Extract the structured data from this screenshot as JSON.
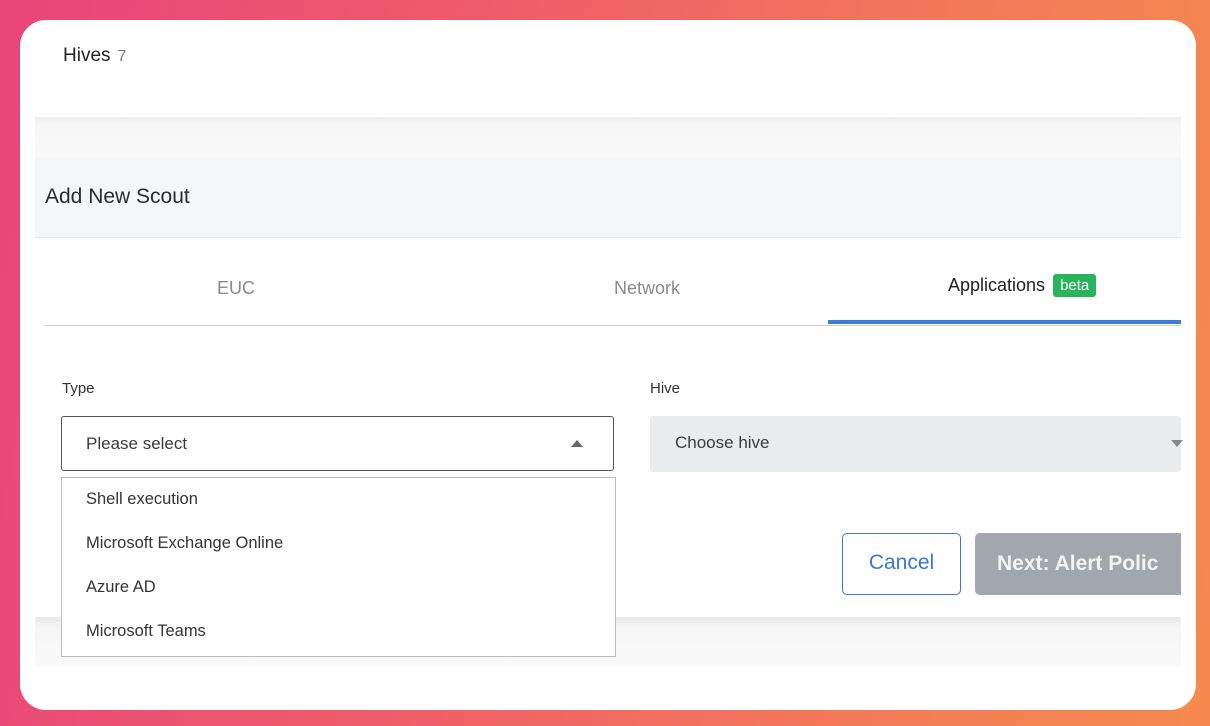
{
  "header": {
    "title": "Hives",
    "count": "7"
  },
  "panel": {
    "title": "Add New Scout"
  },
  "tabs": [
    {
      "label": "EUC"
    },
    {
      "label": "Network"
    },
    {
      "label": "Applications",
      "badge": "beta",
      "active": true
    }
  ],
  "form": {
    "type": {
      "label": "Type",
      "value": "Please select",
      "options": [
        "Shell execution",
        "Microsoft Exchange Online",
        "Azure AD",
        "Microsoft Teams"
      ]
    },
    "hive": {
      "label": "Hive",
      "value": "Choose hive"
    }
  },
  "buttons": {
    "cancel": "Cancel",
    "next": "Next: Alert Polic"
  },
  "colors": {
    "accent": "#3b7dd8",
    "badge": "#27b45a",
    "disabled_button": "#a2a7ad"
  }
}
